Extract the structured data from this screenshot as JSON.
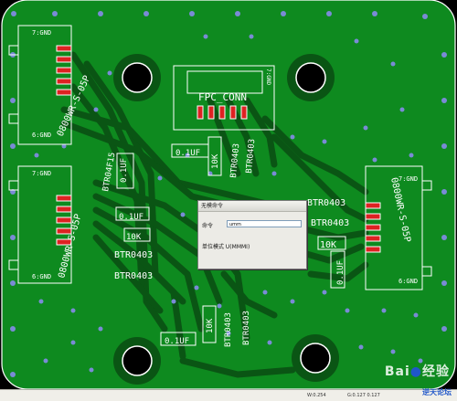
{
  "board": {
    "connectors": [
      {
        "id": "left-top",
        "pin_top": "7:GND",
        "pin_bottom": "6:GND",
        "part": "0800WR-S-05P"
      },
      {
        "id": "left-mid",
        "pin_top": "7:GND",
        "pin_bottom": "6:GND",
        "part": "0800WR-S-05P"
      },
      {
        "id": "right",
        "pin_top": "7:GND",
        "pin_bottom": "6:GND",
        "part": "0800WR-S-05P"
      }
    ],
    "fpc_label": "FPC_CONN",
    "fpc_pin": "7:GND",
    "parts": {
      "cap": "0.1UF",
      "res": "10K",
      "btr": "BTR0403",
      "btr_f": "BTR04F15"
    }
  },
  "dialog": {
    "title": "无模命令",
    "command_label": "命令",
    "command_value": "umm",
    "unit_label": "单位模式 U(MMMI)"
  },
  "statusbar": {
    "grid": "G:0.127 0.127",
    "width": "W:0.254"
  },
  "watermark": {
    "brand": "Bai",
    "brand_suffix": "经验",
    "site": "逆天论坛"
  },
  "colors": {
    "board": "#0e8a1f",
    "board_dark": "#075c12",
    "trace": "#0b5a18",
    "silkscreen": "#ffffff",
    "via": "#7a8bd6"
  }
}
